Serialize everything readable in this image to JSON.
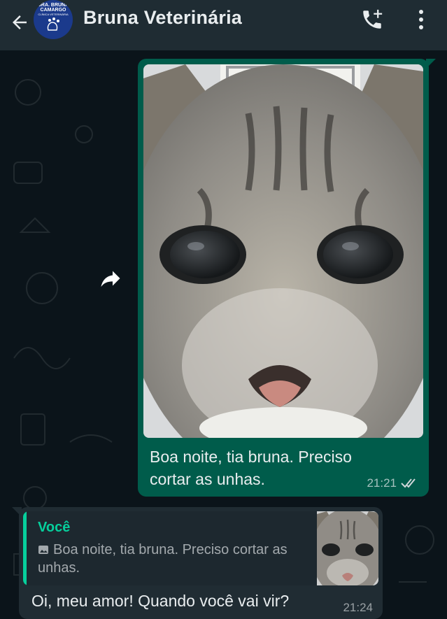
{
  "header": {
    "title": "Bruna Veterinária",
    "avatar_lines": [
      "DRA. BRUNA",
      "CAMARGO",
      "CLÍNICA VETERINÁRIA"
    ],
    "back_icon": "arrow-left-icon",
    "call_icon": "add-call-icon",
    "menu_icon": "more-vertical-icon"
  },
  "messages": {
    "outgoing": {
      "image": "cat-photo",
      "text": "Boa noite, tia bruna. Preciso cortar as unhas.",
      "time": "21:21",
      "status": "read",
      "status_color": "#53bdeb"
    },
    "incoming": {
      "quote_author": "Você",
      "quote_text": "Boa noite, tia bruna. Preciso cortar as unhas.",
      "quote_image": "cat-photo-thumbnail",
      "text": "Oi, meu amor! Quando você vai vir?",
      "time": "21:24"
    }
  },
  "colors": {
    "header_bg": "#1f2c33",
    "chat_bg": "#0b141a",
    "outgoing_bubble": "#005c4b",
    "incoming_bubble": "#202c33",
    "accent": "#06cf9c"
  }
}
